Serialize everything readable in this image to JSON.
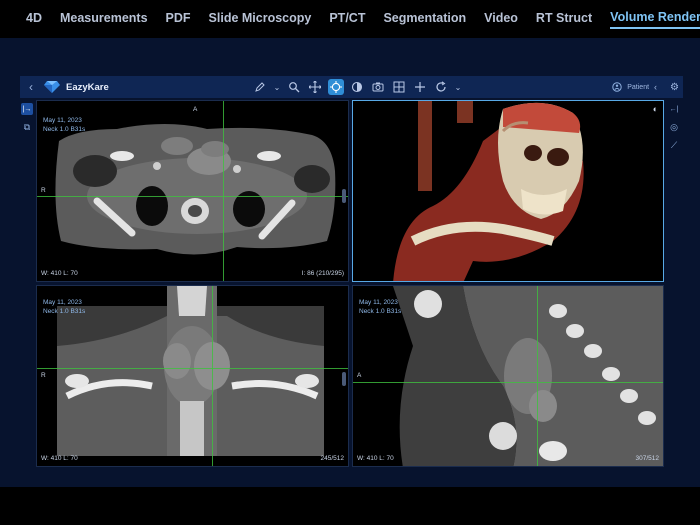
{
  "nav": {
    "tabs": [
      "4D",
      "Measurements",
      "PDF",
      "Slide Microscopy",
      "PT/CT",
      "Segmentation",
      "Video",
      "RT Struct",
      "Volume Rendering"
    ],
    "active_index": 8
  },
  "appbar": {
    "app_name": "EazyKare",
    "patient_label": "Patient",
    "tools": [
      "pencil-icon",
      "search-icon",
      "pan-icon",
      "crosshair-sync-icon",
      "contrast-icon",
      "camera-icon",
      "layout-icon",
      "add-icon",
      "rotate-icon"
    ],
    "active_tool": "crosshair-sync-icon"
  },
  "viewports": {
    "axial": {
      "date": "May 11, 2023",
      "series": "Neck 1.0 B31s",
      "wl": "W: 410  L: 70",
      "slice": "I: 86 (210/295)",
      "orient_top": "A",
      "orient_left": "R"
    },
    "volume": {},
    "coronal": {
      "date": "May 11, 2023",
      "series": "Neck 1.0 B31s",
      "wl": "W: 410  L: 70",
      "slice": "245/512",
      "orient_left": "R"
    },
    "sagittal": {
      "date": "May 11, 2023",
      "series": "Neck 1.0 B31s",
      "wl": "W: 410  L: 70",
      "slice": "307/512",
      "orient_left": "A"
    }
  },
  "colors": {
    "accent": "#7fc4f4",
    "crosshair": "#3fc03f",
    "toolbar": "#0f2654"
  }
}
